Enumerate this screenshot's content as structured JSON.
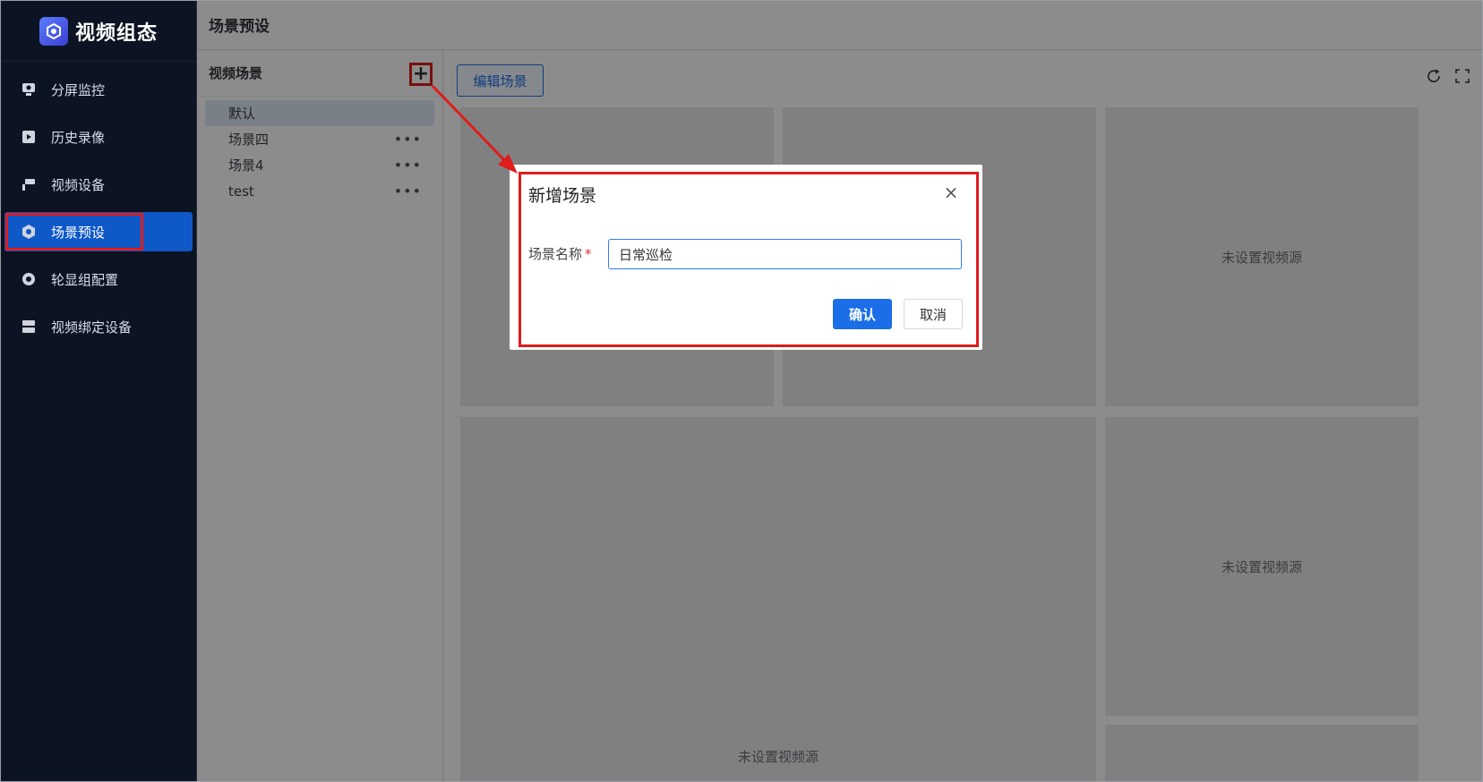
{
  "app": {
    "title": "视频组态"
  },
  "sidebar": {
    "items": [
      {
        "label": "分屏监控",
        "icon": "monitor-icon"
      },
      {
        "label": "历史录像",
        "icon": "film-icon"
      },
      {
        "label": "视频设备",
        "icon": "camera-icon"
      },
      {
        "label": "场景预设",
        "icon": "hexagon-icon",
        "active": true
      },
      {
        "label": "轮显组配置",
        "icon": "rotate-icon"
      },
      {
        "label": "视频绑定设备",
        "icon": "device-icon"
      }
    ]
  },
  "header": {
    "title": "场景预设"
  },
  "scene_panel": {
    "title": "视频场景",
    "add_label": "+",
    "items": [
      "默认",
      "场景四",
      "场景4",
      "test"
    ],
    "more_label": "•••"
  },
  "content": {
    "edit_button": "编辑场景",
    "empty_label": "未设置视频源",
    "partial_label": "频源"
  },
  "dialog": {
    "title": "新增场景",
    "close": "×",
    "field_label": "场景名称",
    "required_mark": "*",
    "field_value": "日常巡检",
    "confirm": "确认",
    "cancel": "取消"
  },
  "colors": {
    "accent": "#1b6ee8",
    "highlight": "#e01c1c",
    "sidebar_bg": "#0c1322"
  }
}
